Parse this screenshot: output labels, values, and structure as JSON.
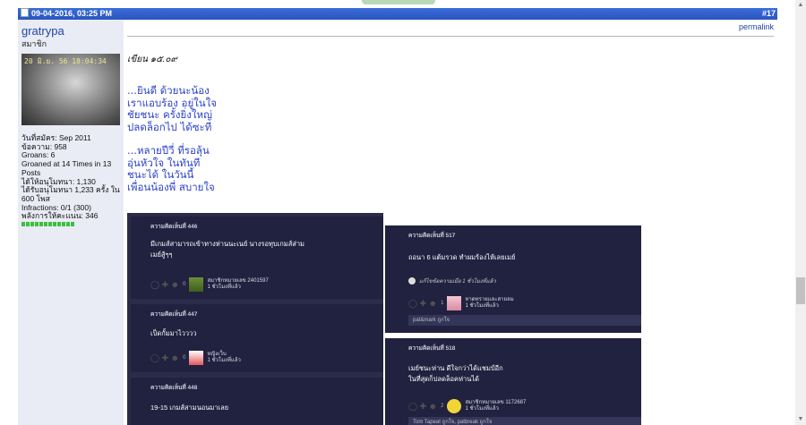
{
  "post": {
    "datetime": "09-04-2016, 03:25 PM",
    "number": "#17",
    "permalink": "permalink"
  },
  "user": {
    "name": "gratrypa",
    "title": "สมาชิก",
    "avatar_stamp": "20 มิ.ย. 56   18:04:34",
    "info": [
      "วันที่สมัคร: Sep 2011",
      "ข้อความ: 958",
      "Groans: 6",
      "Groaned at 14 Times in 13 Posts",
      "ได้ให้อนุโมทนา: 1,130",
      "ได้รับอนุโมทนา 1,233 ครั้ง ใน 600 โพส",
      "Infractions: 0/1 (300)",
      "พลังการให้คะแนน: 346"
    ]
  },
  "content": {
    "intro": "เขียน ๑๕.๐๙",
    "stanza1": [
      "...ยินดี ด้วยนะน้อง",
      "เราแอบร้อง อยู่ในใจ",
      "ชัยชนะ ครั้งยิ่งใหญ่",
      "ปลดล็อกไป ได้ซะที"
    ],
    "stanza2": [
      "...หลายปีวี่ ที่รอลุ้น",
      "อุ่นหัวใจ ในทันที",
      "ชนะได้ ในวันนี้",
      "เพื่อนน้องพี่ สบายใจ"
    ]
  },
  "screenshot_left": {
    "cards": [
      {
        "head": "ความคิดเห็นที่ 446",
        "text": [
          "มีเกมส์สามารถเข้าทางห่านนะเนย์ นางรอทุบเกมส์ส่าม",
          "เมย์สู้ๆๆ"
        ],
        "vote": "0",
        "author": "สมาชิกหมายเลข 2401597",
        "time": "1 ชั่วโมงที่แล้ว"
      },
      {
        "head": "ความคิดเห็นที่ 447",
        "text": [
          "เป็ดกั้มมาไวววว"
        ],
        "vote": "0",
        "author": "หญิงเว็บ",
        "time": "1 ชั่วโมงที่แล้ว"
      },
      {
        "head": "ความคิดเห็นที่ 448",
        "text": [
          "19-15 เกมส์สามนอนมาเลย"
        ],
        "vote": "",
        "author": "",
        "time": ""
      }
    ]
  },
  "screenshot_right": {
    "cards": [
      {
        "head": "ความคิดเห็นที่ 517",
        "text": [
          "ถอนา 6 แต้มรวด ทำผมร้องไห้เลยเมย์"
        ],
        "edit_note": "แก้ไขข้อความเมื่อ 1 ชั่วโมงที่แล้ว",
        "vote": "1",
        "author": "หาดทรายและสายลม",
        "time": "1 ชั่วโมงที่แล้ว",
        "reply": "pat&mark ถูกใจ"
      },
      {
        "head": "ความคิดเห็นที่ 518",
        "text": [
          "เมย์ชนะห่าน ดีใจกว่าได้แชมป์อีก",
          "ในที่สุดก็ปลดล็อคห่านได้"
        ],
        "vote": "2",
        "author": "สมาชิกหมายเลข 1172687",
        "time": "1 ชั่วโมงที่แล้ว",
        "reply": "Tom Tapeat ถูกใจ, patbreak ถูกใจ"
      }
    ]
  },
  "colors": {
    "header_blue": "#2a55bf",
    "username_blue": "#2144a6",
    "poem_blue": "#2b42c9",
    "sidebar_bg": "#e9ecf4",
    "screenshot_bg": "#212140",
    "reputation_green": "#3cbf3c"
  }
}
